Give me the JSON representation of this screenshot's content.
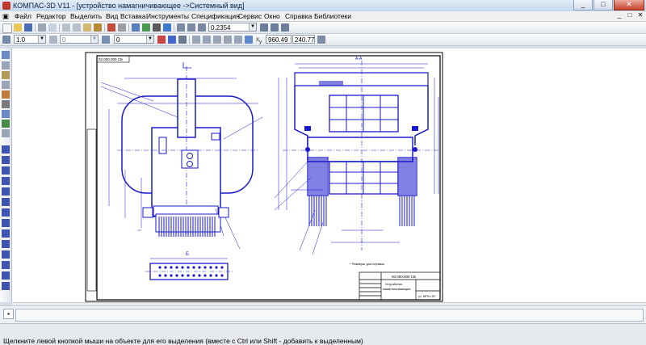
{
  "window": {
    "title": "КОМПАС-3D V11 - [устройство намагничивающее ->Системный вид]",
    "controls": [
      "_",
      "□",
      "✕"
    ]
  },
  "menu": {
    "items": [
      {
        "label": "Файл"
      },
      {
        "label": "Редактор"
      },
      {
        "label": "Выделить"
      },
      {
        "label": "Вид"
      },
      {
        "label": "Вставка"
      },
      {
        "label": "Инструменты"
      },
      {
        "label": "Спецификация"
      },
      {
        "label": "Сервис"
      },
      {
        "label": "Окно"
      },
      {
        "label": "Справка"
      },
      {
        "label": "Библиотеки"
      }
    ],
    "right_controls": [
      "_",
      "□",
      "✕"
    ]
  },
  "toolbar1": {
    "zoom_value": "0.2354"
  },
  "toolbar2": {
    "line_scale": "1.0",
    "state_value": "0",
    "layer_value": "0",
    "coord_x": "960.49",
    "coord_y": "240.77"
  },
  "drawing": {
    "stamp_code": "02.000.000 СБ",
    "title_code": "00.000.000 СБ",
    "title_name_line1": "Устройство",
    "title_name_line2": "намагничивающее",
    "org_text": "гр. МПН-20",
    "note": "* Размеры для справок",
    "view_label": "Б",
    "section_label": "А-А"
  },
  "statusbar": {
    "message": "Щелкните левой кнопкой мыши на объекте для его выделения (вместе с Ctrl или Shift - добавить к выделенным)"
  },
  "colors": {
    "drawing_line": "#1a1acc",
    "frame": "#000000",
    "title_bar_gradient_top": "#e3ecf7"
  }
}
